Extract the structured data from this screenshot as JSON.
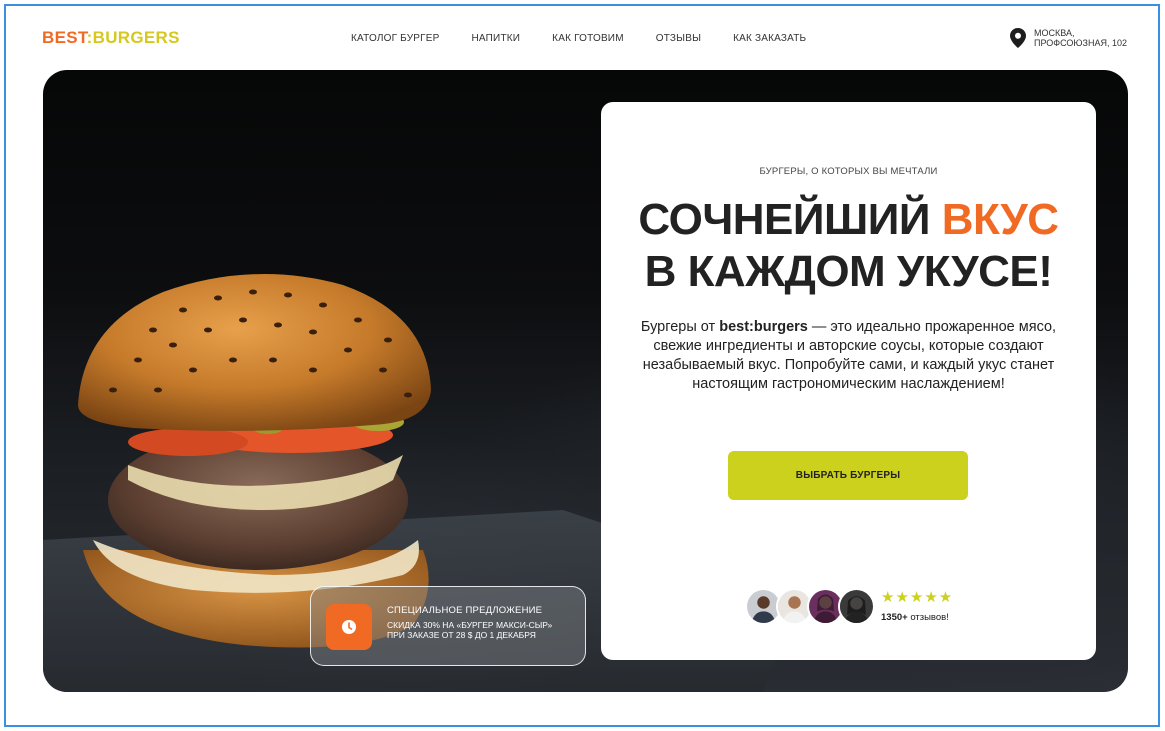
{
  "logo": {
    "part1": "BEST",
    "separator": ":",
    "part2": "BURGERS"
  },
  "nav": {
    "catalog": "КАТОЛОГ БУРГЕР",
    "drinks": "НАПИТКИ",
    "how_we_cook": "КАК ГОТОВИМ",
    "reviews": "ОТЗЫВЫ",
    "how_to_order": "КАК ЗАКАЗАТЬ"
  },
  "location": {
    "icon": "map-pin-icon",
    "line1": "МОСКВА,",
    "line2": "ПРОФСОЮЗНАЯ, 102"
  },
  "hero": {
    "kicker": "БУРГЕРЫ, О КОТОРЫХ ВЫ МЕЧТАЛИ",
    "headline_part1": "СОЧНЕЙШИЙ ",
    "headline_accent": "ВКУС",
    "headline_line2": "В КАЖДОМ УКУСЕ!",
    "desc_prefix": "Бургеры от ",
    "desc_brand": "best:burgers",
    "desc_rest": " — это идеально прожаренное мясо, свежие ингредиенты и авторские соусы, которые создают незабываемый вкус. Попробуйте сами, и каждый укус станет настоящим гастрономическим наслаждением!",
    "cta_label": "ВЫБРАТЬ БУРГЕРЫ"
  },
  "social_proof": {
    "stars": "★★★★★",
    "count_number": "1350+",
    "count_suffix": " отзывов!",
    "rating_value": 5
  },
  "offer": {
    "icon": "clock-icon",
    "title": "СПЕЦИАЛЬНОЕ ПРЕДЛОЖЕНИЕ",
    "text": "СКИДКА 30% НА «БУРГЕР МАКСИ-СЫР» ПРИ ЗАКАЗЕ ОТ 28 $ ДО 1 ДЕКАБРЯ"
  },
  "colors": {
    "accent_orange": "#f06a23",
    "accent_yellow": "#ccd11e",
    "frame_blue": "#3b8fe0"
  }
}
